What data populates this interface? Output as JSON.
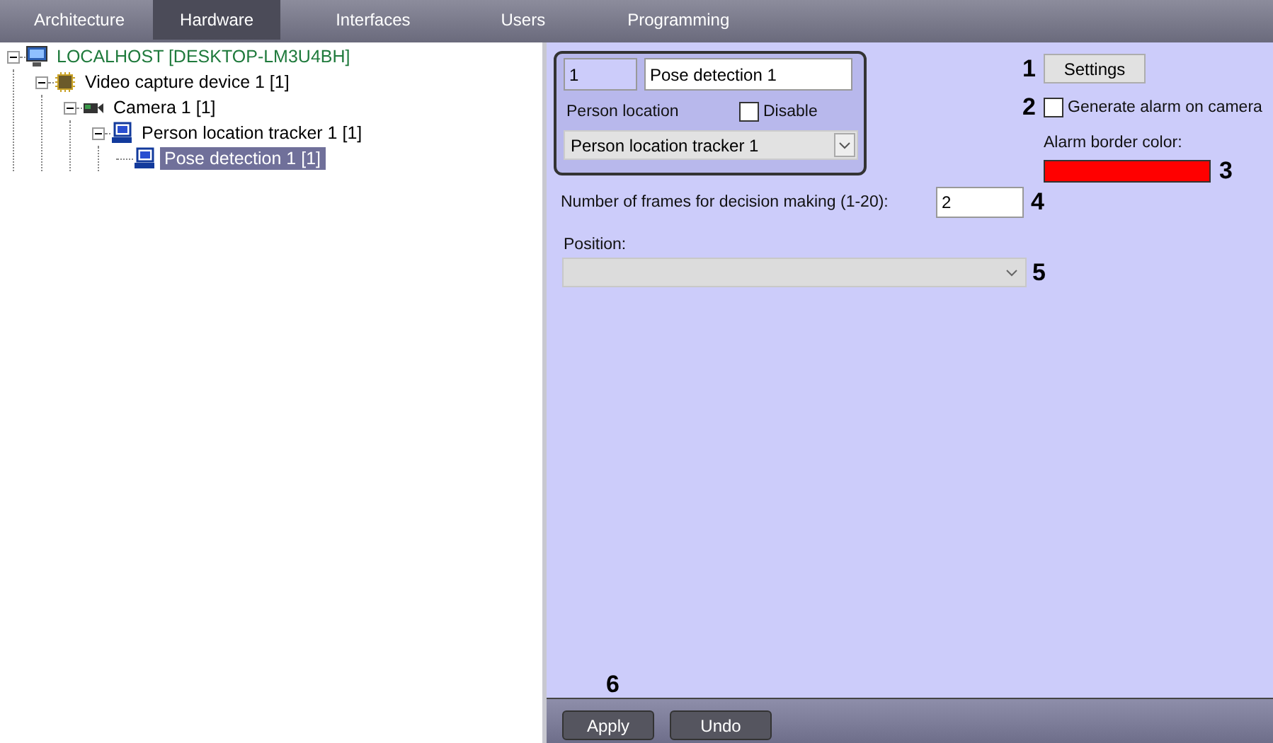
{
  "tabs": [
    {
      "label": "Architecture",
      "selected": false
    },
    {
      "label": "Hardware",
      "selected": true
    },
    {
      "label": "Interfaces",
      "selected": false
    },
    {
      "label": "Users",
      "selected": false
    },
    {
      "label": "Programming",
      "selected": false
    }
  ],
  "tree": [
    {
      "label": "LOCALHOST [DESKTOP-LM3U4BH]",
      "kind": "server",
      "expanded": true,
      "selected": false,
      "children": [
        {
          "label": "Video capture device 1 [1]",
          "kind": "device",
          "expanded": true,
          "selected": false,
          "children": [
            {
              "label": "Camera 1 [1]",
              "kind": "camera",
              "expanded": true,
              "selected": false,
              "children": [
                {
                  "label": "Person location tracker 1 [1]",
                  "kind": "computer",
                  "expanded": true,
                  "selected": false,
                  "children": [
                    {
                      "label": "Pose detection 1 [1]",
                      "kind": "computer",
                      "selected": true
                    }
                  ]
                }
              ]
            }
          ]
        }
      ]
    }
  ],
  "object": {
    "id_value": "1",
    "name_value": "Pose detection 1",
    "location_label": "Person location",
    "disable": {
      "label": "Disable",
      "checked": false
    },
    "location_value": "Person location tracker 1"
  },
  "settings_button": {
    "label": "Settings",
    "callout": "1"
  },
  "generate_alarm": {
    "label": "Generate alarm on camera",
    "checked": false,
    "callout": "2"
  },
  "alarm_color": {
    "label": "Alarm border color:",
    "color": "#ff0000",
    "callout": "3"
  },
  "frames": {
    "label": "Number of frames for decision making (1-20):",
    "value": "2",
    "callout": "4"
  },
  "position": {
    "label": "Position:",
    "callout": "5"
  },
  "footer": {
    "callout": "6",
    "buttons": [
      "Apply",
      "Undo"
    ]
  }
}
